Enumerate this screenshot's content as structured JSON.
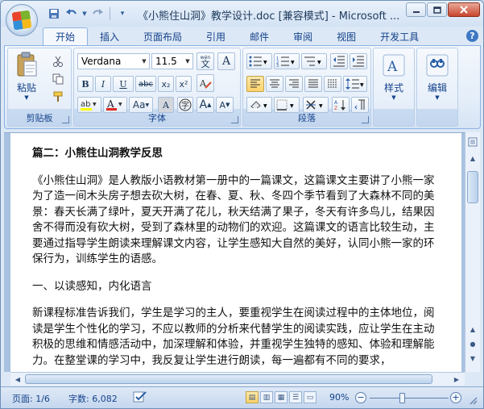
{
  "window": {
    "title": "《小熊住山洞》教学设计.doc [兼容模式] - Microsoft ...",
    "controls": [
      "minimize-icon",
      "maximize-icon",
      "close-icon"
    ]
  },
  "quick_access": [
    "save-icon",
    "undo-icon",
    "redo-icon",
    "customize-icon"
  ],
  "tabs": [
    "开始",
    "插入",
    "页面布局",
    "引用",
    "邮件",
    "审阅",
    "视图",
    "开发工具"
  ],
  "ribbon": {
    "clipboard": {
      "label": "剪贴板",
      "paste_label": "粘贴"
    },
    "font": {
      "label": "字体",
      "font_name": "Verdana",
      "font_size": "11.5",
      "wen_button": "wén\n文",
      "A_button": "A",
      "bold": "B",
      "italic": "I",
      "underline": "U",
      "strikethrough": "abc",
      "subscript": "x₂",
      "superscript": "x²",
      "aa_button": "Aa",
      "grow": "A",
      "shrink": "A",
      "char_border": "A",
      "enclose": "字",
      "font_color": "A"
    },
    "paragraph": {
      "label": "段落"
    },
    "styles": {
      "label": "样式"
    },
    "editing": {
      "label": "编辑"
    }
  },
  "document": {
    "heading": "篇二：小熊住山洞教学反思",
    "paragraphs": [
      "《小熊住山洞》是人教版小语教材第一册中的一篇课文，这篇课文主要讲了小熊一家为了造一间木头房子想去砍大树，在春、夏、秋、冬四个季节看到了大森林不同的美景：春天长满了绿叶，夏天开满了花儿，秋天结满了果子，冬天有许多鸟儿，结果因舍不得而没有砍大树，受到了森林里的动物们的欢迎。这篇课文的语言比较生动，主要通过指导学生朗读来理解课文内容，让学生感知大自然的美好，认同小熊一家的环保行为，训练学生的语感。",
      "一、以读感知，内化语言",
      "新课程标准告诉我们，学生是学习的主人，要重视学生在阅读过程中的主体地位，阅读是学生个性化的学习，不应以教师的分析来代替学生的阅读实践，应让学生在主动积极的思维和情感活动中，加深理解和体验，并重视学生独特的感知、体验和理解能力。在整堂课的学习中，我反复让学生进行朗读，每一遍都有不同的要求，"
    ]
  },
  "statusbar": {
    "page": "页面: 1/6",
    "words": "字数: 6,082",
    "zoom": "90%",
    "zoom_minus": "−",
    "zoom_plus": "+"
  }
}
